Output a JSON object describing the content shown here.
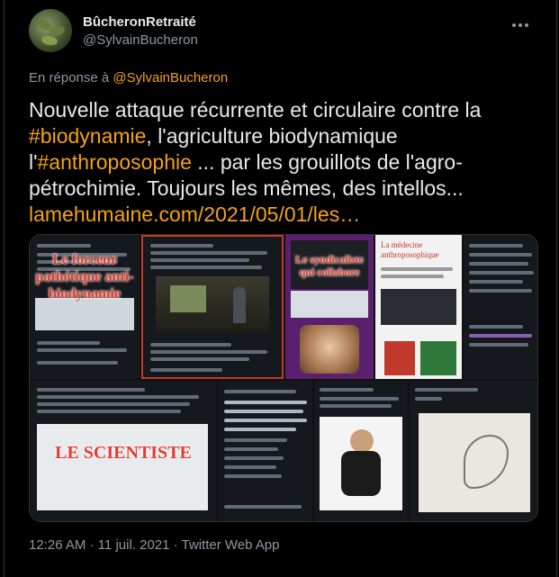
{
  "author": {
    "display_name": "BûcheronRetraité",
    "handle": "@SylvainBucheron"
  },
  "reply": {
    "prefix": "En réponse à",
    "to": "@SylvainBucheron"
  },
  "tweet": {
    "text_1": "Nouvelle attaque récurrente et circulaire contre la ",
    "hashtag_1": "#biodynamie",
    "text_2": ", l'agriculture biodynamique l'",
    "hashtag_2": "#anthroposophie",
    "text_3": " ... par les grouillots de l'agro-pétrochimie. Toujours les mêmes, des intellos... ",
    "link": "lamehumaine.com/2021/05/01/les…"
  },
  "media": {
    "overlay_1": "Le forceur pathétique anti-biodynamie",
    "overlay_2": "Le syndicaliste qui collabore",
    "overlay_3": "LE SCIENTISTE",
    "book_title": "La médecine anthroposophique"
  },
  "footer": {
    "timestamp": "12:26 AM · 11 juil. 2021 · Twitter Web App"
  },
  "colors": {
    "accent": "#f4a11b",
    "background": "#000000"
  }
}
